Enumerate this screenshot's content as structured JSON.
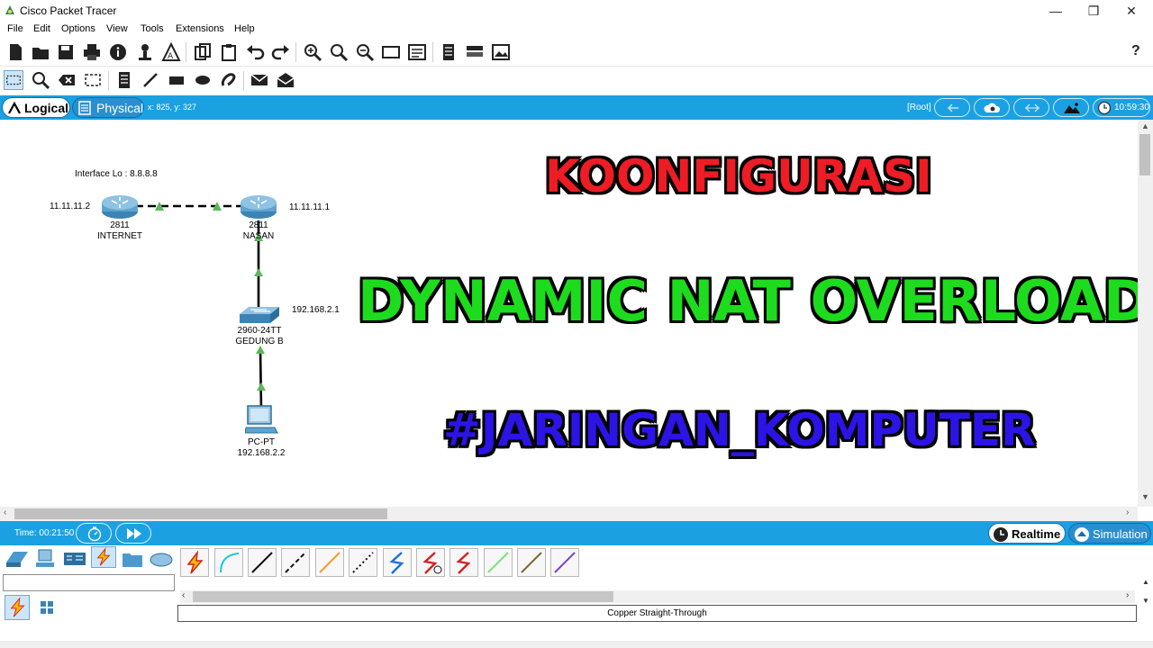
{
  "window": {
    "title": "Cisco Packet Tracer",
    "controls": [
      "—",
      "❐",
      "✕"
    ]
  },
  "menu": [
    "File",
    "Edit",
    "Options",
    "View",
    "Tools",
    "Extensions",
    "Help"
  ],
  "toolbar": {
    "help_label": "?"
  },
  "modebar": {
    "logical_label": "Logical",
    "physical_label": "Physical",
    "coords": "x: 825, y: 327",
    "root_label": "[Root]",
    "clock": "10:59:30"
  },
  "topology": {
    "annotation": "Interface Lo : 8.8.8.8",
    "router_internet": {
      "model": "2811",
      "name": "INTERNET",
      "ip": "11.11.11.2"
    },
    "router_nasan": {
      "model": "2811",
      "name": "NASAN",
      "ip": "11.11.11.1"
    },
    "switch": {
      "model": "2960-24TT",
      "name": "GEDUNG B",
      "ip": "192.168.2.1"
    },
    "pc": {
      "model": "PC-PT",
      "ip": "192.168.2.2"
    }
  },
  "overlay": {
    "line1": "KOONFIGURASI",
    "line2": "DYNAMIC NAT OVERLOAD",
    "line3": "#JARINGAN_KOMPUTER"
  },
  "bottombar": {
    "time": "Time: 00:21:50",
    "realtime_label": "Realtime",
    "simulation_label": "Simulation"
  },
  "devicepanel": {
    "search_placeholder": "",
    "selected_cable": "Copper Straight-Through"
  },
  "colors": {
    "accent_blue": "#1ba1e2",
    "title_red": "#ee1c25",
    "title_green": "#1ddc1d",
    "title_blue": "#2c14e6",
    "link_green": "#5cb85c"
  }
}
